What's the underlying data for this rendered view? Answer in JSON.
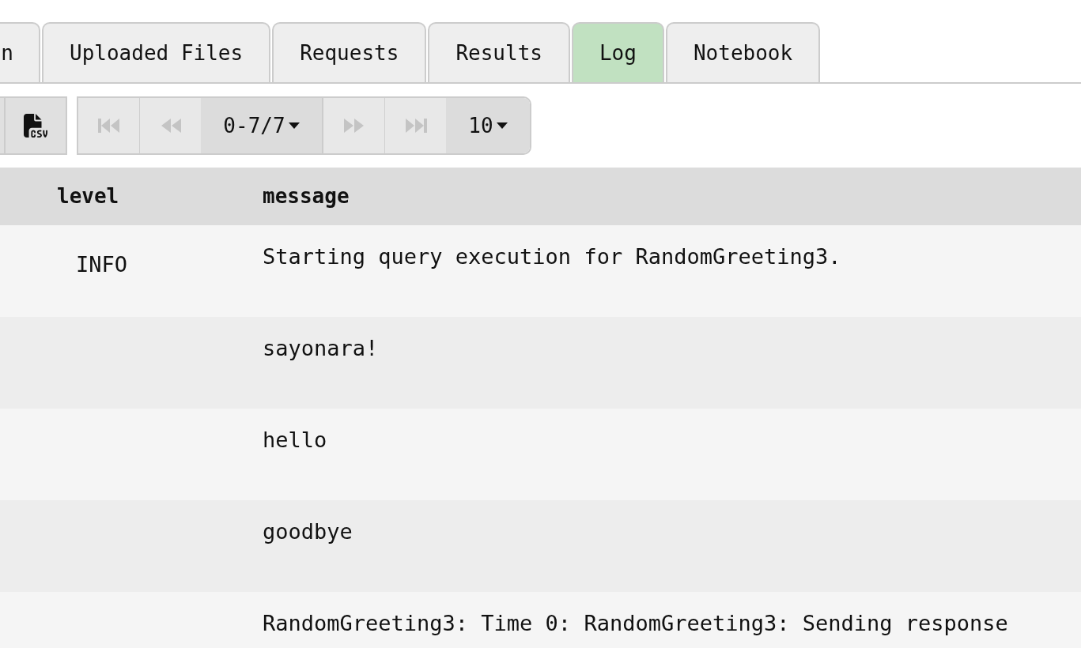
{
  "tabs": [
    {
      "label": "n",
      "selected": false
    },
    {
      "label": "Uploaded Files",
      "selected": false
    },
    {
      "label": "Requests",
      "selected": false
    },
    {
      "label": "Results",
      "selected": false
    },
    {
      "label": "Log",
      "selected": true
    },
    {
      "label": "Notebook",
      "selected": false
    }
  ],
  "toolbar": {
    "pagination": {
      "range": "0-7/7",
      "page_size": "10",
      "first_disabled": true,
      "prev_disabled": true,
      "next_disabled": true,
      "last_disabled": true
    }
  },
  "table": {
    "columns": [
      "level",
      "message"
    ],
    "rows": [
      {
        "level": "INFO",
        "message": "Starting query execution for RandomGreeting3."
      },
      {
        "level": "",
        "message": "sayonara!"
      },
      {
        "level": "",
        "message": "hello"
      },
      {
        "level": "",
        "message": "goodbye"
      },
      {
        "level": "",
        "message": "RandomGreeting3: Time 0: RandomGreeting3: Sending response"
      }
    ]
  }
}
